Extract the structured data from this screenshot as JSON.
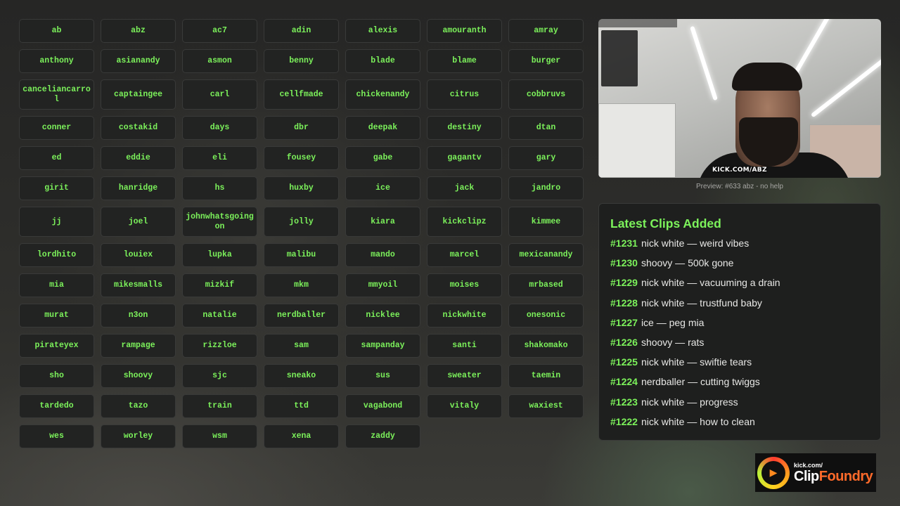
{
  "streamers": [
    "ab",
    "abz",
    "ac7",
    "adin",
    "alexis",
    "amouranth",
    "amray",
    "anthony",
    "asianandy",
    "asmon",
    "benny",
    "blade",
    "blame",
    "burger",
    "canceliancarrol",
    "captaingee",
    "carl",
    "cellfmade",
    "chickenandy",
    "citrus",
    "cobbruvs",
    "conner",
    "costakid",
    "days",
    "dbr",
    "deepak",
    "destiny",
    "dtan",
    "ed",
    "eddie",
    "eli",
    "fousey",
    "gabe",
    "gagantv",
    "gary",
    "girit",
    "hanridge",
    "hs",
    "huxby",
    "ice",
    "jack",
    "jandro",
    "jj",
    "joel",
    "johnwhatsgoingon",
    "jolly",
    "kiara",
    "kickclipz",
    "kimmee",
    "lordhito",
    "louiex",
    "lupka",
    "malibu",
    "mando",
    "marcel",
    "mexicanandy",
    "mia",
    "mikesmalls",
    "mizkif",
    "mkm",
    "mmyoil",
    "moises",
    "mrbased",
    "murat",
    "n3on",
    "natalie",
    "nerdballer",
    "nicklee",
    "nickwhite",
    "onesonic",
    "pirateyex",
    "rampage",
    "rizzloe",
    "sam",
    "sampanday",
    "santi",
    "shakomako",
    "sho",
    "shoovy",
    "sjc",
    "sneako",
    "sus",
    "sweater",
    "taemin",
    "tardedo",
    "tazo",
    "train",
    "ttd",
    "vagabond",
    "vitaly",
    "waxiest",
    "wes",
    "worley",
    "wsm",
    "xena",
    "zaddy"
  ],
  "preview": {
    "caption": "Preview: #633 abz - no help",
    "watermark": "KICK.COM/ABZ"
  },
  "latest_clips": {
    "title": "Latest Clips Added",
    "items": [
      {
        "num": "#1231",
        "text": "nick white — weird vibes"
      },
      {
        "num": "#1230",
        "text": "shoovy — 500k gone"
      },
      {
        "num": "#1229",
        "text": "nick white — vacuuming a drain"
      },
      {
        "num": "#1228",
        "text": "nick white — trustfund baby"
      },
      {
        "num": "#1227",
        "text": "ice — peg mia"
      },
      {
        "num": "#1226",
        "text": "shoovy — rats"
      },
      {
        "num": "#1225",
        "text": "nick white — swiftie tears"
      },
      {
        "num": "#1224",
        "text": "nerdballer — cutting twiggs"
      },
      {
        "num": "#1223",
        "text": "nick white — progress"
      },
      {
        "num": "#1222",
        "text": "nick white — how to clean"
      }
    ]
  },
  "logo": {
    "small": "kick.com/",
    "big_part1": "Clip",
    "big_part2": "Foundry"
  },
  "colors": {
    "accent_green": "#7cf25b",
    "button_bg": "#222322",
    "panel_bg": "#1e1f1e"
  }
}
